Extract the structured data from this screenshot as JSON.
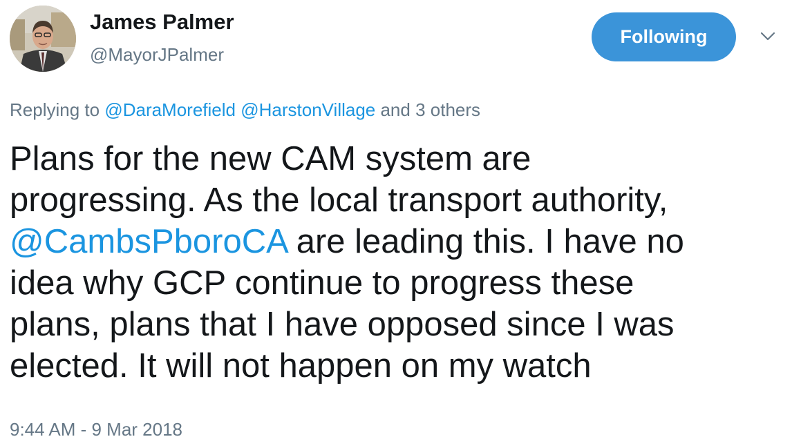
{
  "user": {
    "display_name": "James Palmer",
    "handle": "@MayorJPalmer",
    "avatar_icon": "profile-photo"
  },
  "actions": {
    "follow_label": "Following",
    "menu_icon": "chevron-down-icon"
  },
  "reply": {
    "prefix": "Replying to ",
    "mention_1": "@DaraMorefield",
    "mention_2": "@HarstonVillage",
    "others": " and 3 others"
  },
  "tweet": {
    "line_1": "Plans for the new CAM system are",
    "line_2": "progressing. As the local transport authority,",
    "mention": "@CambsPboroCA",
    "line_3_rest": " are leading this. I have no",
    "line_4": "idea why GCP continue to progress these",
    "line_5": "plans, plans that I have opposed since I was",
    "line_6": "elected. It will not happen on my watch"
  },
  "meta": {
    "timestamp": "9:44 AM - 9 Mar 2018"
  },
  "colors": {
    "accent": "#1b95e0",
    "button": "#3b94d9",
    "secondary_text": "#657786",
    "primary_text": "#14171a"
  }
}
